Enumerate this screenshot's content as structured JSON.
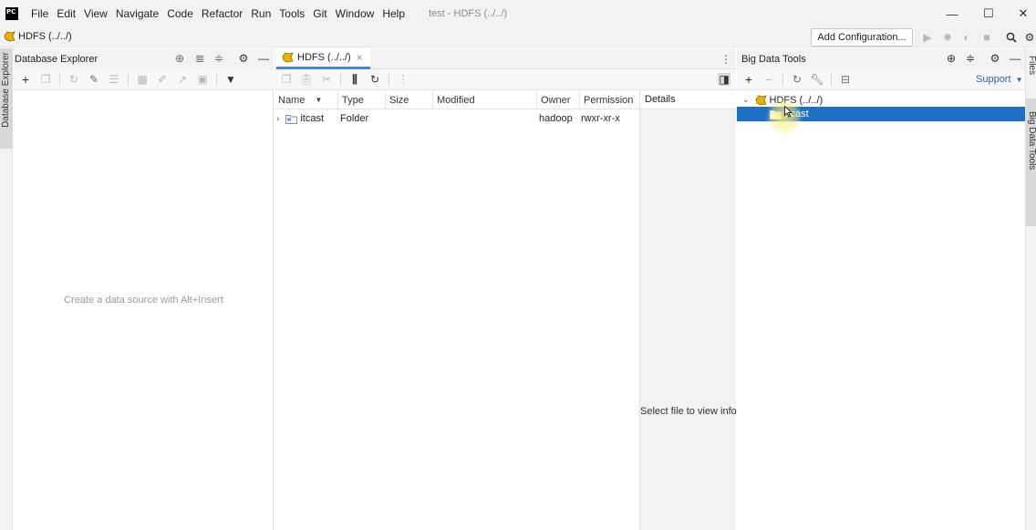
{
  "menu": [
    "File",
    "Edit",
    "View",
    "Navigate",
    "Code",
    "Refactor",
    "Run",
    "Tools",
    "Git",
    "Window",
    "Help"
  ],
  "window_title": "test - HDFS (../../)",
  "window_controls": {
    "minimize": "—",
    "maximize": "☐",
    "close": "✕"
  },
  "navbar": {
    "crumb": "HDFS (../../)",
    "add_configuration": "Add Configuration..."
  },
  "left_stripe": {
    "tab": "Database Explorer"
  },
  "database_explorer": {
    "title": "Database Explorer",
    "empty_text": "Create a data source with Alt+Insert"
  },
  "editor": {
    "tab_label": "HDFS (../../)",
    "tab_close": "×",
    "columns": {
      "name": "Name",
      "type": "Type",
      "size": "Size",
      "modified": "Modified",
      "owner": "Owner",
      "permission": "Permission",
      "details": "Details"
    },
    "files": [
      {
        "name": "itcast",
        "type": "Folder",
        "size": "",
        "modified": "",
        "owner": "hadoop",
        "permission": "rwxr-xr-x"
      }
    ],
    "details_empty": "Select file to view info"
  },
  "big_data_tools": {
    "title": "Big Data Tools",
    "support": "Support",
    "tree_root": "HDFS (../../)",
    "tree_child": "itcast",
    "selected_color": "#1f6fc5"
  },
  "right_stripe": {
    "files_tab": "Files",
    "bdt_tab": "Big Data Tools"
  },
  "icons": [
    "app-logo-icon",
    "hdfs-icon",
    "run-icon",
    "debug-icon",
    "coverage-icon",
    "stop-icon",
    "search-icon",
    "settings-icon",
    "add-icon",
    "copy-icon",
    "refresh-icon",
    "edit-icon",
    "table-icon",
    "filter-icon",
    "crosshair-icon",
    "expand-icon",
    "collapse-icon",
    "gear-icon",
    "minimize-icon",
    "more-icon",
    "folder-icon",
    "chevron-right-icon",
    "chevron-down-icon",
    "wrench-icon",
    "layout-icon"
  ],
  "accent": "#4a83d3"
}
